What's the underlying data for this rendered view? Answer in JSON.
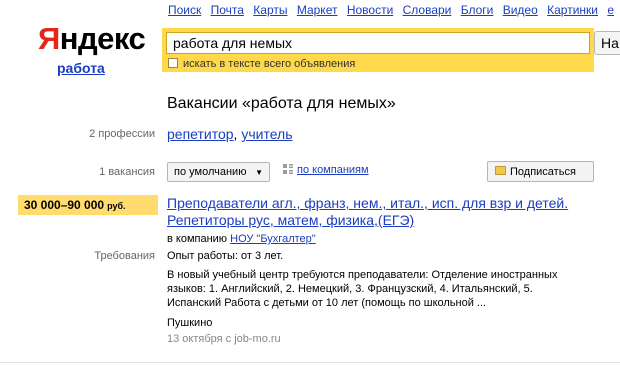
{
  "logo": {
    "first_letter": "Я",
    "rest": "ндекс",
    "service": "работа"
  },
  "nav": [
    "Поиск",
    "Почта",
    "Карты",
    "Маркет",
    "Новости",
    "Словари",
    "Блоги",
    "Видео",
    "Картинки",
    "е"
  ],
  "search": {
    "value": "работа для немых",
    "button_label": "На",
    "option_label": "искать в тексте всего объявления"
  },
  "results": {
    "title": "Вакансии «работа для немых»",
    "professions_label": "2 профессии",
    "professions": [
      "репетитор",
      "учитель"
    ],
    "vacancies_label": "1 вакансия",
    "sort_label": "по умолчанию",
    "by_company_label": "по компаниям",
    "subscribe_label": "Подписаться"
  },
  "vacancy": {
    "salary": "30 000–90 000",
    "currency": "руб.",
    "title": "Преподаватели агл., франз, нем., итал., исп. для взр и детей. Репетиторы рус, матем, физика,(ЕГЭ)",
    "company_prefix": "в компанию",
    "company": "НОУ \"Бухгалтер\"",
    "requirements_label": "Требования",
    "experience": "Опыт работы: от 3 лет.",
    "description": "В новый учебный центр требуются преподаватели: Отделение иностранных языков: 1. Английский, 2. Немецкий, 3. Французский, 4. Итальянский, 5. Испанский Работа с детьми от 10 лет (помощь по школьной ...",
    "city": "Пушкино",
    "date": "13 октября с job-mo.ru"
  },
  "colors": {
    "brand_red": "#e5261b",
    "link": "#1a3dc1",
    "search_frame": "#ffd84c",
    "salary_bg": "#ffdc6d"
  },
  "icons": [
    "envelope-icon",
    "grid-icon",
    "caret-down-icon",
    "checkbox-icon"
  ]
}
